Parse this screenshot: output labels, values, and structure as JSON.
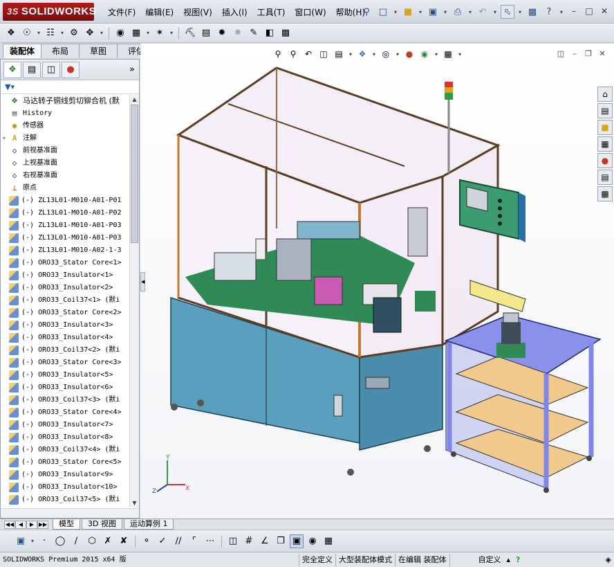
{
  "app": {
    "brand": "SOLIDWORKS",
    "brand_prefix": "3S"
  },
  "menu": [
    "文件(F)",
    "编辑(E)",
    "视图(V)",
    "插入(I)",
    "工具(T)",
    "窗口(W)",
    "帮助(H)"
  ],
  "command_tabs": [
    "装配体",
    "布局",
    "草图",
    "评估"
  ],
  "feature_tree": {
    "filter_icon": "filter-icon",
    "root": "马达转子铜线剪切铆合机  (默",
    "items": [
      {
        "label": "History",
        "icon": "history-icon",
        "expand": ""
      },
      {
        "label": "传感器",
        "icon": "sensor-icon",
        "expand": ""
      },
      {
        "label": "注解",
        "icon": "annotation-icon",
        "expand": "+"
      },
      {
        "label": "前视基准面",
        "icon": "plane-icon",
        "expand": ""
      },
      {
        "label": "上视基准面",
        "icon": "plane-icon",
        "expand": ""
      },
      {
        "label": "右视基准面",
        "icon": "plane-icon",
        "expand": ""
      },
      {
        "label": "原点",
        "icon": "origin-icon",
        "expand": ""
      },
      {
        "label": "(-) ZL13L01-M010-A01-P01",
        "icon": "part",
        "expand": ""
      },
      {
        "label": "(-) ZL13L01-M010-A01-P02",
        "icon": "part",
        "expand": ""
      },
      {
        "label": "(-) ZL13L01-M010-A01-P03",
        "icon": "part",
        "expand": ""
      },
      {
        "label": "(-) ZL13L01-M010-A01-P03",
        "icon": "part",
        "expand": ""
      },
      {
        "label": "(-) ZL13L01-M010-A02-1-3",
        "icon": "part",
        "expand": ""
      },
      {
        "label": "(-) ORO33_Stator Core<1>",
        "icon": "part",
        "expand": ""
      },
      {
        "label": "(-) ORO33_Insulator<1>",
        "icon": "part",
        "expand": ""
      },
      {
        "label": "(-) ORO33_Insulator<2>",
        "icon": "part",
        "expand": ""
      },
      {
        "label": "(-) ORO33_Coil37<1> (默i",
        "icon": "part",
        "expand": ""
      },
      {
        "label": "(-) ORO33_Stator Core<2>",
        "icon": "part",
        "expand": ""
      },
      {
        "label": "(-) ORO33_Insulator<3>",
        "icon": "part",
        "expand": ""
      },
      {
        "label": "(-) ORO33_Insulator<4>",
        "icon": "part",
        "expand": ""
      },
      {
        "label": "(-) ORO33_Coil37<2> (默i",
        "icon": "part",
        "expand": ""
      },
      {
        "label": "(-) ORO33_Stator Core<3>",
        "icon": "part",
        "expand": ""
      },
      {
        "label": "(-) ORO33_Insulator<5>",
        "icon": "part",
        "expand": ""
      },
      {
        "label": "(-) ORO33_Insulator<6>",
        "icon": "part",
        "expand": ""
      },
      {
        "label": "(-) ORO33_Coil37<3> (默i",
        "icon": "part",
        "expand": ""
      },
      {
        "label": "(-) ORO33_Stator Core<4>",
        "icon": "part",
        "expand": ""
      },
      {
        "label": "(-) ORO33_Insulator<7>",
        "icon": "part",
        "expand": ""
      },
      {
        "label": "(-) ORO33_Insulator<8>",
        "icon": "part",
        "expand": ""
      },
      {
        "label": "(-) ORO33_Coil37<4> (默i",
        "icon": "part",
        "expand": ""
      },
      {
        "label": "(-) ORO33_Stator Core<5>",
        "icon": "part",
        "expand": ""
      },
      {
        "label": "(-) ORO33_Insulator<9>",
        "icon": "part",
        "expand": ""
      },
      {
        "label": "(-) ORO33_Insulator<10>",
        "icon": "part",
        "expand": ""
      },
      {
        "label": "(-) ORO33_Coil37<5> (默i",
        "icon": "part",
        "expand": ""
      }
    ]
  },
  "bottom_tabs": [
    "模型",
    "3D 视图",
    "运动算例 1"
  ],
  "status": {
    "product": "SOLIDWORKS Premium 2015 x64 版",
    "definition": "完全定义",
    "mode": "大型装配体模式",
    "editing": "在编辑 装配体",
    "custom": "自定义"
  },
  "colors": {
    "cabinet": "#4f95b5",
    "frame": "#6b4a2f",
    "glass": "#f1e9f5",
    "plate": "#2f8a55",
    "table": "#7f86e6",
    "shelf": "#f2c98c",
    "hmi": "#3c9b6f"
  }
}
